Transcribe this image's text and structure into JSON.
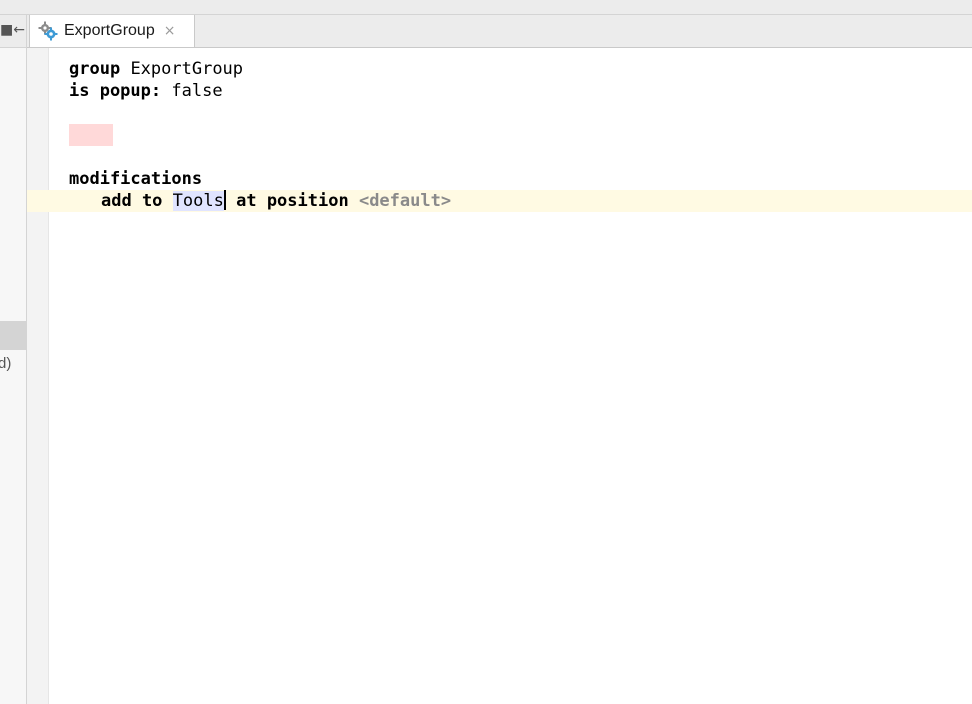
{
  "tab": {
    "title": "ExportGroup",
    "close_glyph": "×",
    "icon": "gear-icon"
  },
  "side": {
    "collapse_glyph": "■←",
    "cut_text": "d)"
  },
  "code": {
    "line1_kw": "group",
    "line1_val": "ExportGroup",
    "line2_kw": "is popup:",
    "line2_val": "false",
    "line4_kw": "modifications",
    "line5_kw1": "add to",
    "line5_ref": "Tools",
    "line5_kw2": "at position",
    "line5_default": "<default>"
  },
  "colors": {
    "caret_row": "#fffae3",
    "error_highlight": "#ffd9d9",
    "reference_highlight": "#e0e4ff",
    "gutter": "#f3f3f3"
  }
}
